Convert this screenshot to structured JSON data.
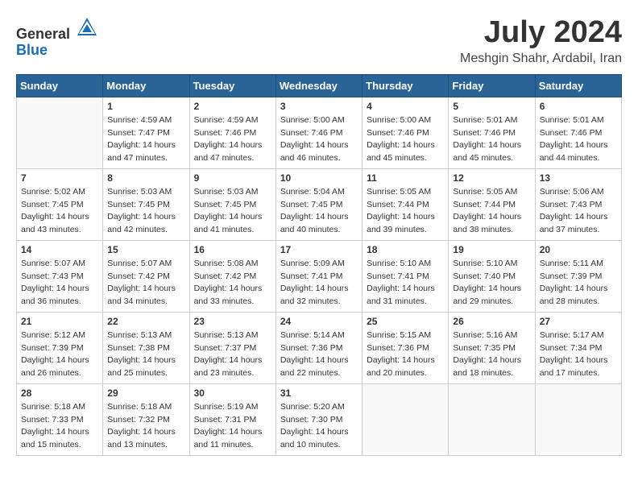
{
  "header": {
    "logo_general": "General",
    "logo_blue": "Blue",
    "month_year": "July 2024",
    "location": "Meshgin Shahr, Ardabil, Iran"
  },
  "days_of_week": [
    "Sunday",
    "Monday",
    "Tuesday",
    "Wednesday",
    "Thursday",
    "Friday",
    "Saturday"
  ],
  "weeks": [
    [
      {
        "day": "",
        "content": ""
      },
      {
        "day": "1",
        "content": "Sunrise: 4:59 AM\nSunset: 7:47 PM\nDaylight: 14 hours\nand 47 minutes."
      },
      {
        "day": "2",
        "content": "Sunrise: 4:59 AM\nSunset: 7:46 PM\nDaylight: 14 hours\nand 47 minutes."
      },
      {
        "day": "3",
        "content": "Sunrise: 5:00 AM\nSunset: 7:46 PM\nDaylight: 14 hours\nand 46 minutes."
      },
      {
        "day": "4",
        "content": "Sunrise: 5:00 AM\nSunset: 7:46 PM\nDaylight: 14 hours\nand 45 minutes."
      },
      {
        "day": "5",
        "content": "Sunrise: 5:01 AM\nSunset: 7:46 PM\nDaylight: 14 hours\nand 45 minutes."
      },
      {
        "day": "6",
        "content": "Sunrise: 5:01 AM\nSunset: 7:46 PM\nDaylight: 14 hours\nand 44 minutes."
      }
    ],
    [
      {
        "day": "7",
        "content": "Sunrise: 5:02 AM\nSunset: 7:45 PM\nDaylight: 14 hours\nand 43 minutes."
      },
      {
        "day": "8",
        "content": "Sunrise: 5:03 AM\nSunset: 7:45 PM\nDaylight: 14 hours\nand 42 minutes."
      },
      {
        "day": "9",
        "content": "Sunrise: 5:03 AM\nSunset: 7:45 PM\nDaylight: 14 hours\nand 41 minutes."
      },
      {
        "day": "10",
        "content": "Sunrise: 5:04 AM\nSunset: 7:45 PM\nDaylight: 14 hours\nand 40 minutes."
      },
      {
        "day": "11",
        "content": "Sunrise: 5:05 AM\nSunset: 7:44 PM\nDaylight: 14 hours\nand 39 minutes."
      },
      {
        "day": "12",
        "content": "Sunrise: 5:05 AM\nSunset: 7:44 PM\nDaylight: 14 hours\nand 38 minutes."
      },
      {
        "day": "13",
        "content": "Sunrise: 5:06 AM\nSunset: 7:43 PM\nDaylight: 14 hours\nand 37 minutes."
      }
    ],
    [
      {
        "day": "14",
        "content": "Sunrise: 5:07 AM\nSunset: 7:43 PM\nDaylight: 14 hours\nand 36 minutes."
      },
      {
        "day": "15",
        "content": "Sunrise: 5:07 AM\nSunset: 7:42 PM\nDaylight: 14 hours\nand 34 minutes."
      },
      {
        "day": "16",
        "content": "Sunrise: 5:08 AM\nSunset: 7:42 PM\nDaylight: 14 hours\nand 33 minutes."
      },
      {
        "day": "17",
        "content": "Sunrise: 5:09 AM\nSunset: 7:41 PM\nDaylight: 14 hours\nand 32 minutes."
      },
      {
        "day": "18",
        "content": "Sunrise: 5:10 AM\nSunset: 7:41 PM\nDaylight: 14 hours\nand 31 minutes."
      },
      {
        "day": "19",
        "content": "Sunrise: 5:10 AM\nSunset: 7:40 PM\nDaylight: 14 hours\nand 29 minutes."
      },
      {
        "day": "20",
        "content": "Sunrise: 5:11 AM\nSunset: 7:39 PM\nDaylight: 14 hours\nand 28 minutes."
      }
    ],
    [
      {
        "day": "21",
        "content": "Sunrise: 5:12 AM\nSunset: 7:39 PM\nDaylight: 14 hours\nand 26 minutes."
      },
      {
        "day": "22",
        "content": "Sunrise: 5:13 AM\nSunset: 7:38 PM\nDaylight: 14 hours\nand 25 minutes."
      },
      {
        "day": "23",
        "content": "Sunrise: 5:13 AM\nSunset: 7:37 PM\nDaylight: 14 hours\nand 23 minutes."
      },
      {
        "day": "24",
        "content": "Sunrise: 5:14 AM\nSunset: 7:36 PM\nDaylight: 14 hours\nand 22 minutes."
      },
      {
        "day": "25",
        "content": "Sunrise: 5:15 AM\nSunset: 7:36 PM\nDaylight: 14 hours\nand 20 minutes."
      },
      {
        "day": "26",
        "content": "Sunrise: 5:16 AM\nSunset: 7:35 PM\nDaylight: 14 hours\nand 18 minutes."
      },
      {
        "day": "27",
        "content": "Sunrise: 5:17 AM\nSunset: 7:34 PM\nDaylight: 14 hours\nand 17 minutes."
      }
    ],
    [
      {
        "day": "28",
        "content": "Sunrise: 5:18 AM\nSunset: 7:33 PM\nDaylight: 14 hours\nand 15 minutes."
      },
      {
        "day": "29",
        "content": "Sunrise: 5:18 AM\nSunset: 7:32 PM\nDaylight: 14 hours\nand 13 minutes."
      },
      {
        "day": "30",
        "content": "Sunrise: 5:19 AM\nSunset: 7:31 PM\nDaylight: 14 hours\nand 11 minutes."
      },
      {
        "day": "31",
        "content": "Sunrise: 5:20 AM\nSunset: 7:30 PM\nDaylight: 14 hours\nand 10 minutes."
      },
      {
        "day": "",
        "content": ""
      },
      {
        "day": "",
        "content": ""
      },
      {
        "day": "",
        "content": ""
      }
    ]
  ]
}
